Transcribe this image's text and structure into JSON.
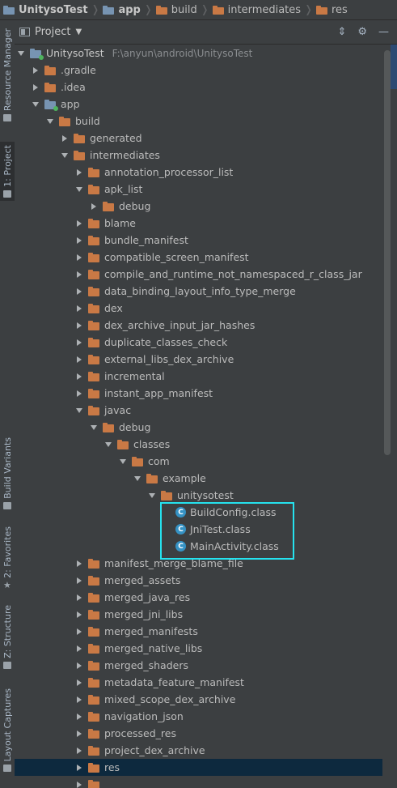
{
  "breadcrumb": {
    "items": [
      "UnitysoTest",
      "app",
      "build",
      "intermediates",
      "res"
    ]
  },
  "side_tabs": {
    "resource_manager": "Resource Manager",
    "project": "1: Project",
    "build_variants": "Build Variants",
    "favorites": "2: Favorites",
    "structure": "Z: Structure",
    "layout_captures": "Layout Captures"
  },
  "panel": {
    "title": "Project",
    "tools": {
      "collapse": "⇕",
      "settings": "⚙",
      "hide": "—"
    }
  },
  "tree": {
    "root_name": "UnitysoTest",
    "root_path": "F:\\anyun\\android\\UnitysoTest",
    "gradle": ".gradle",
    "idea": ".idea",
    "app": "app",
    "build": "build",
    "generated": "generated",
    "intermediates": "intermediates",
    "i_annotation": "annotation_processor_list",
    "i_apk_list": "apk_list",
    "i_apk_debug": "debug",
    "i_blame": "blame",
    "i_bundle_manifest": "bundle_manifest",
    "i_compatible": "compatible_screen_manifest",
    "i_compile": "compile_and_runtime_not_namespaced_r_class_jar",
    "i_data_binding": "data_binding_layout_info_type_merge",
    "i_dex": "dex",
    "i_dex_archive": "dex_archive_input_jar_hashes",
    "i_duplicate": "duplicate_classes_check",
    "i_external": "external_libs_dex_archive",
    "i_incremental": "incremental",
    "i_instant": "instant_app_manifest",
    "i_javac": "javac",
    "i_javac_debug": "debug",
    "i_classes": "classes",
    "i_com": "com",
    "i_example": "example",
    "i_unitysotest": "unitysotest",
    "c_build_config": "BuildConfig.class",
    "c_jni_test": "JniTest.class",
    "c_main_activity": "MainActivity.class",
    "i_manifest_merge": "manifest_merge_blame_file",
    "i_merged_assets": "merged_assets",
    "i_merged_java_res": "merged_java_res",
    "i_merged_jni_libs": "merged_jni_libs",
    "i_merged_manifests": "merged_manifests",
    "i_merged_native_libs": "merged_native_libs",
    "i_merged_shaders": "merged_shaders",
    "i_metadata": "metadata_feature_manifest",
    "i_mixed_scope": "mixed_scope_dex_archive",
    "i_navigation": "navigation_json",
    "i_processed_res": "processed_res",
    "i_project_dex": "project_dex_archive",
    "i_res": "res",
    "class_badge": "C"
  },
  "colors": {
    "background": "#3c3f41",
    "folder": "#c97945",
    "module_folder": "#7794b2",
    "selection": "#0d293e",
    "highlight_box": "#25e2ee",
    "class_icon": "#3592c4"
  }
}
